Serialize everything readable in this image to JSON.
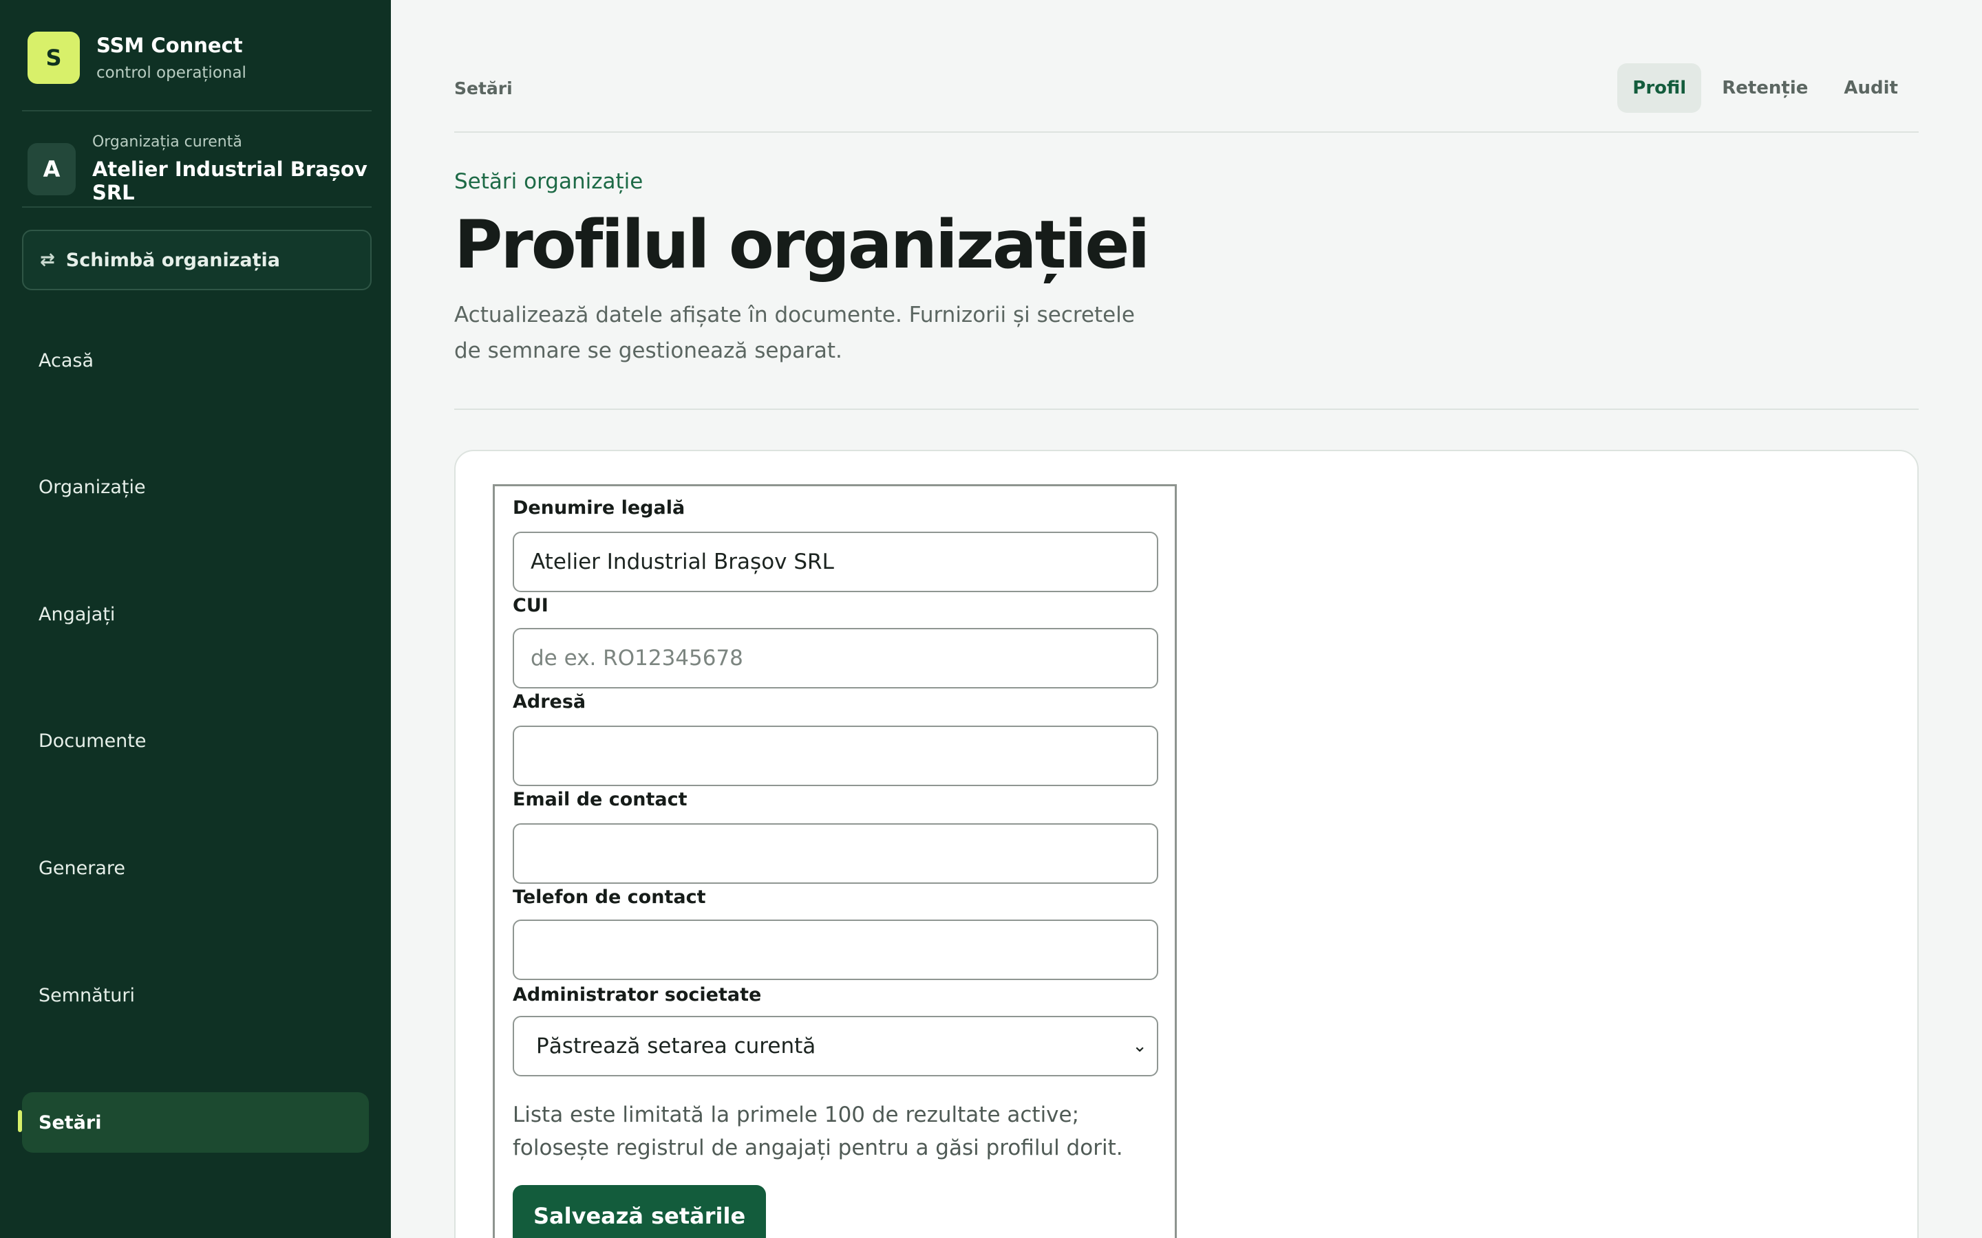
{
  "sidebar": {
    "brand": {
      "logo_letter": "S",
      "name": "SSM Connect",
      "subtitle": "control operațional"
    },
    "org": {
      "avatar_letter": "A",
      "label": "Organizația curentă",
      "name": "Atelier Industrial Brașov SRL"
    },
    "switch_button": {
      "icon": "⇄",
      "label": "Schimbă organizația"
    },
    "nav": [
      {
        "label": "Acasă"
      },
      {
        "label": "Organizație"
      },
      {
        "label": "Angajați"
      },
      {
        "label": "Documente"
      },
      {
        "label": "Generare"
      },
      {
        "label": "Semnături"
      },
      {
        "label": "Setări",
        "active": true
      }
    ]
  },
  "header": {
    "breadcrumb": "Setări",
    "tabs": [
      {
        "label": "Profil",
        "active": true
      },
      {
        "label": "Retenție"
      },
      {
        "label": "Audit"
      }
    ]
  },
  "main": {
    "eyebrow": "Setări organizație",
    "title": "Profilul organizației",
    "description": "Actualizează datele afișate în documente. Furnizorii și secretele de semnare se gestionează separat."
  },
  "form": {
    "legal_name": {
      "label": "Denumire legală",
      "value": "Atelier Industrial Brașov SRL"
    },
    "cui": {
      "label": "CUI",
      "value": "",
      "placeholder": "de ex. RO12345678"
    },
    "address": {
      "label": "Adresă",
      "value": ""
    },
    "email": {
      "label": "Email de contact",
      "value": ""
    },
    "phone": {
      "label": "Telefon de contact",
      "value": ""
    },
    "administrator": {
      "label": "Administrator societate",
      "selected": "Păstrează setarea curentă"
    },
    "hint": "Lista este limitată la primele 100 de rezultate active; folosește registrul de angajați pentru a găsi profilul dorit.",
    "save_label": "Salvează setările"
  },
  "colors": {
    "sidebar_bg": "#0f3124",
    "accent_lime": "#d8f06a",
    "primary_green": "#135c3c",
    "page_bg": "#f4f6f5"
  }
}
